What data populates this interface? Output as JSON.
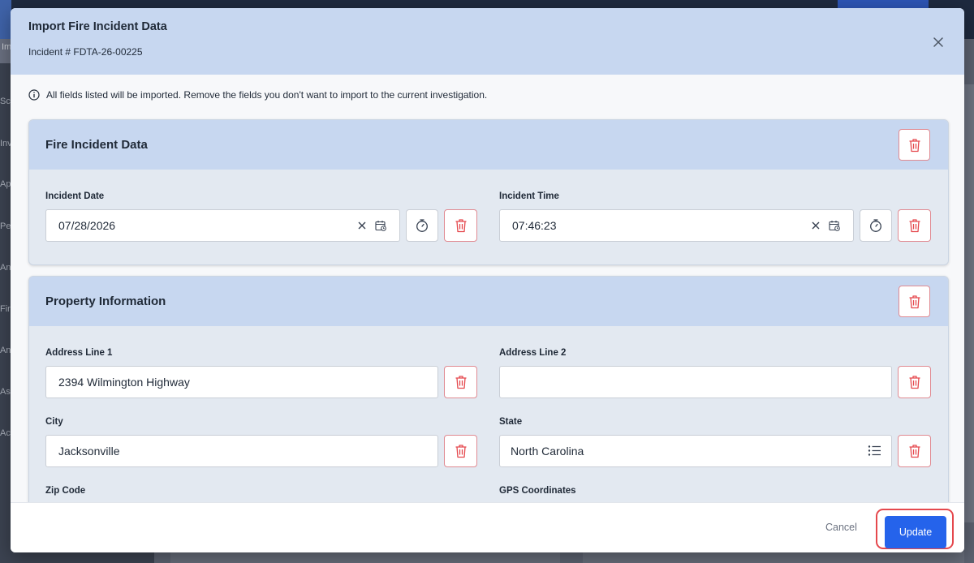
{
  "background": {
    "tab_fragment": "Im",
    "nav_fragments": [
      "Sc",
      "Inv",
      "Ap",
      "Pe",
      "An",
      "Fir",
      "An",
      "As",
      "Ac"
    ]
  },
  "modal": {
    "title": "Import Fire Incident Data",
    "subtitle": "Incident # FDTA-26-00225",
    "info_text": "All fields listed will be imported. Remove the fields you don't want to import to the current investigation.",
    "sections": {
      "fire_incident": {
        "title": "Fire Incident Data",
        "incident_date_label": "Incident Date",
        "incident_date_value": "07/28/2026",
        "incident_time_label": "Incident Time",
        "incident_time_value": "07:46:23"
      },
      "property": {
        "title": "Property Information",
        "address1_label": "Address Line 1",
        "address1_value": "2394 Wilmington Highway",
        "address2_label": "Address Line 2",
        "address2_value": "",
        "city_label": "City",
        "city_value": "Jacksonville",
        "state_label": "State",
        "state_value": "North Carolina",
        "zip_label": "Zip Code",
        "gps_label": "GPS Coordinates"
      }
    },
    "footer": {
      "cancel_label": "Cancel",
      "update_label": "Update"
    }
  },
  "colors": {
    "header_bg": "#c7d7f0",
    "section_bg": "#e3e9f1",
    "danger": "#e5484d",
    "primary": "#2563eb"
  },
  "icons": [
    "close-icon",
    "info-icon",
    "trash-icon",
    "clear-icon",
    "calendar-icon",
    "stopwatch-icon",
    "list-icon"
  ]
}
